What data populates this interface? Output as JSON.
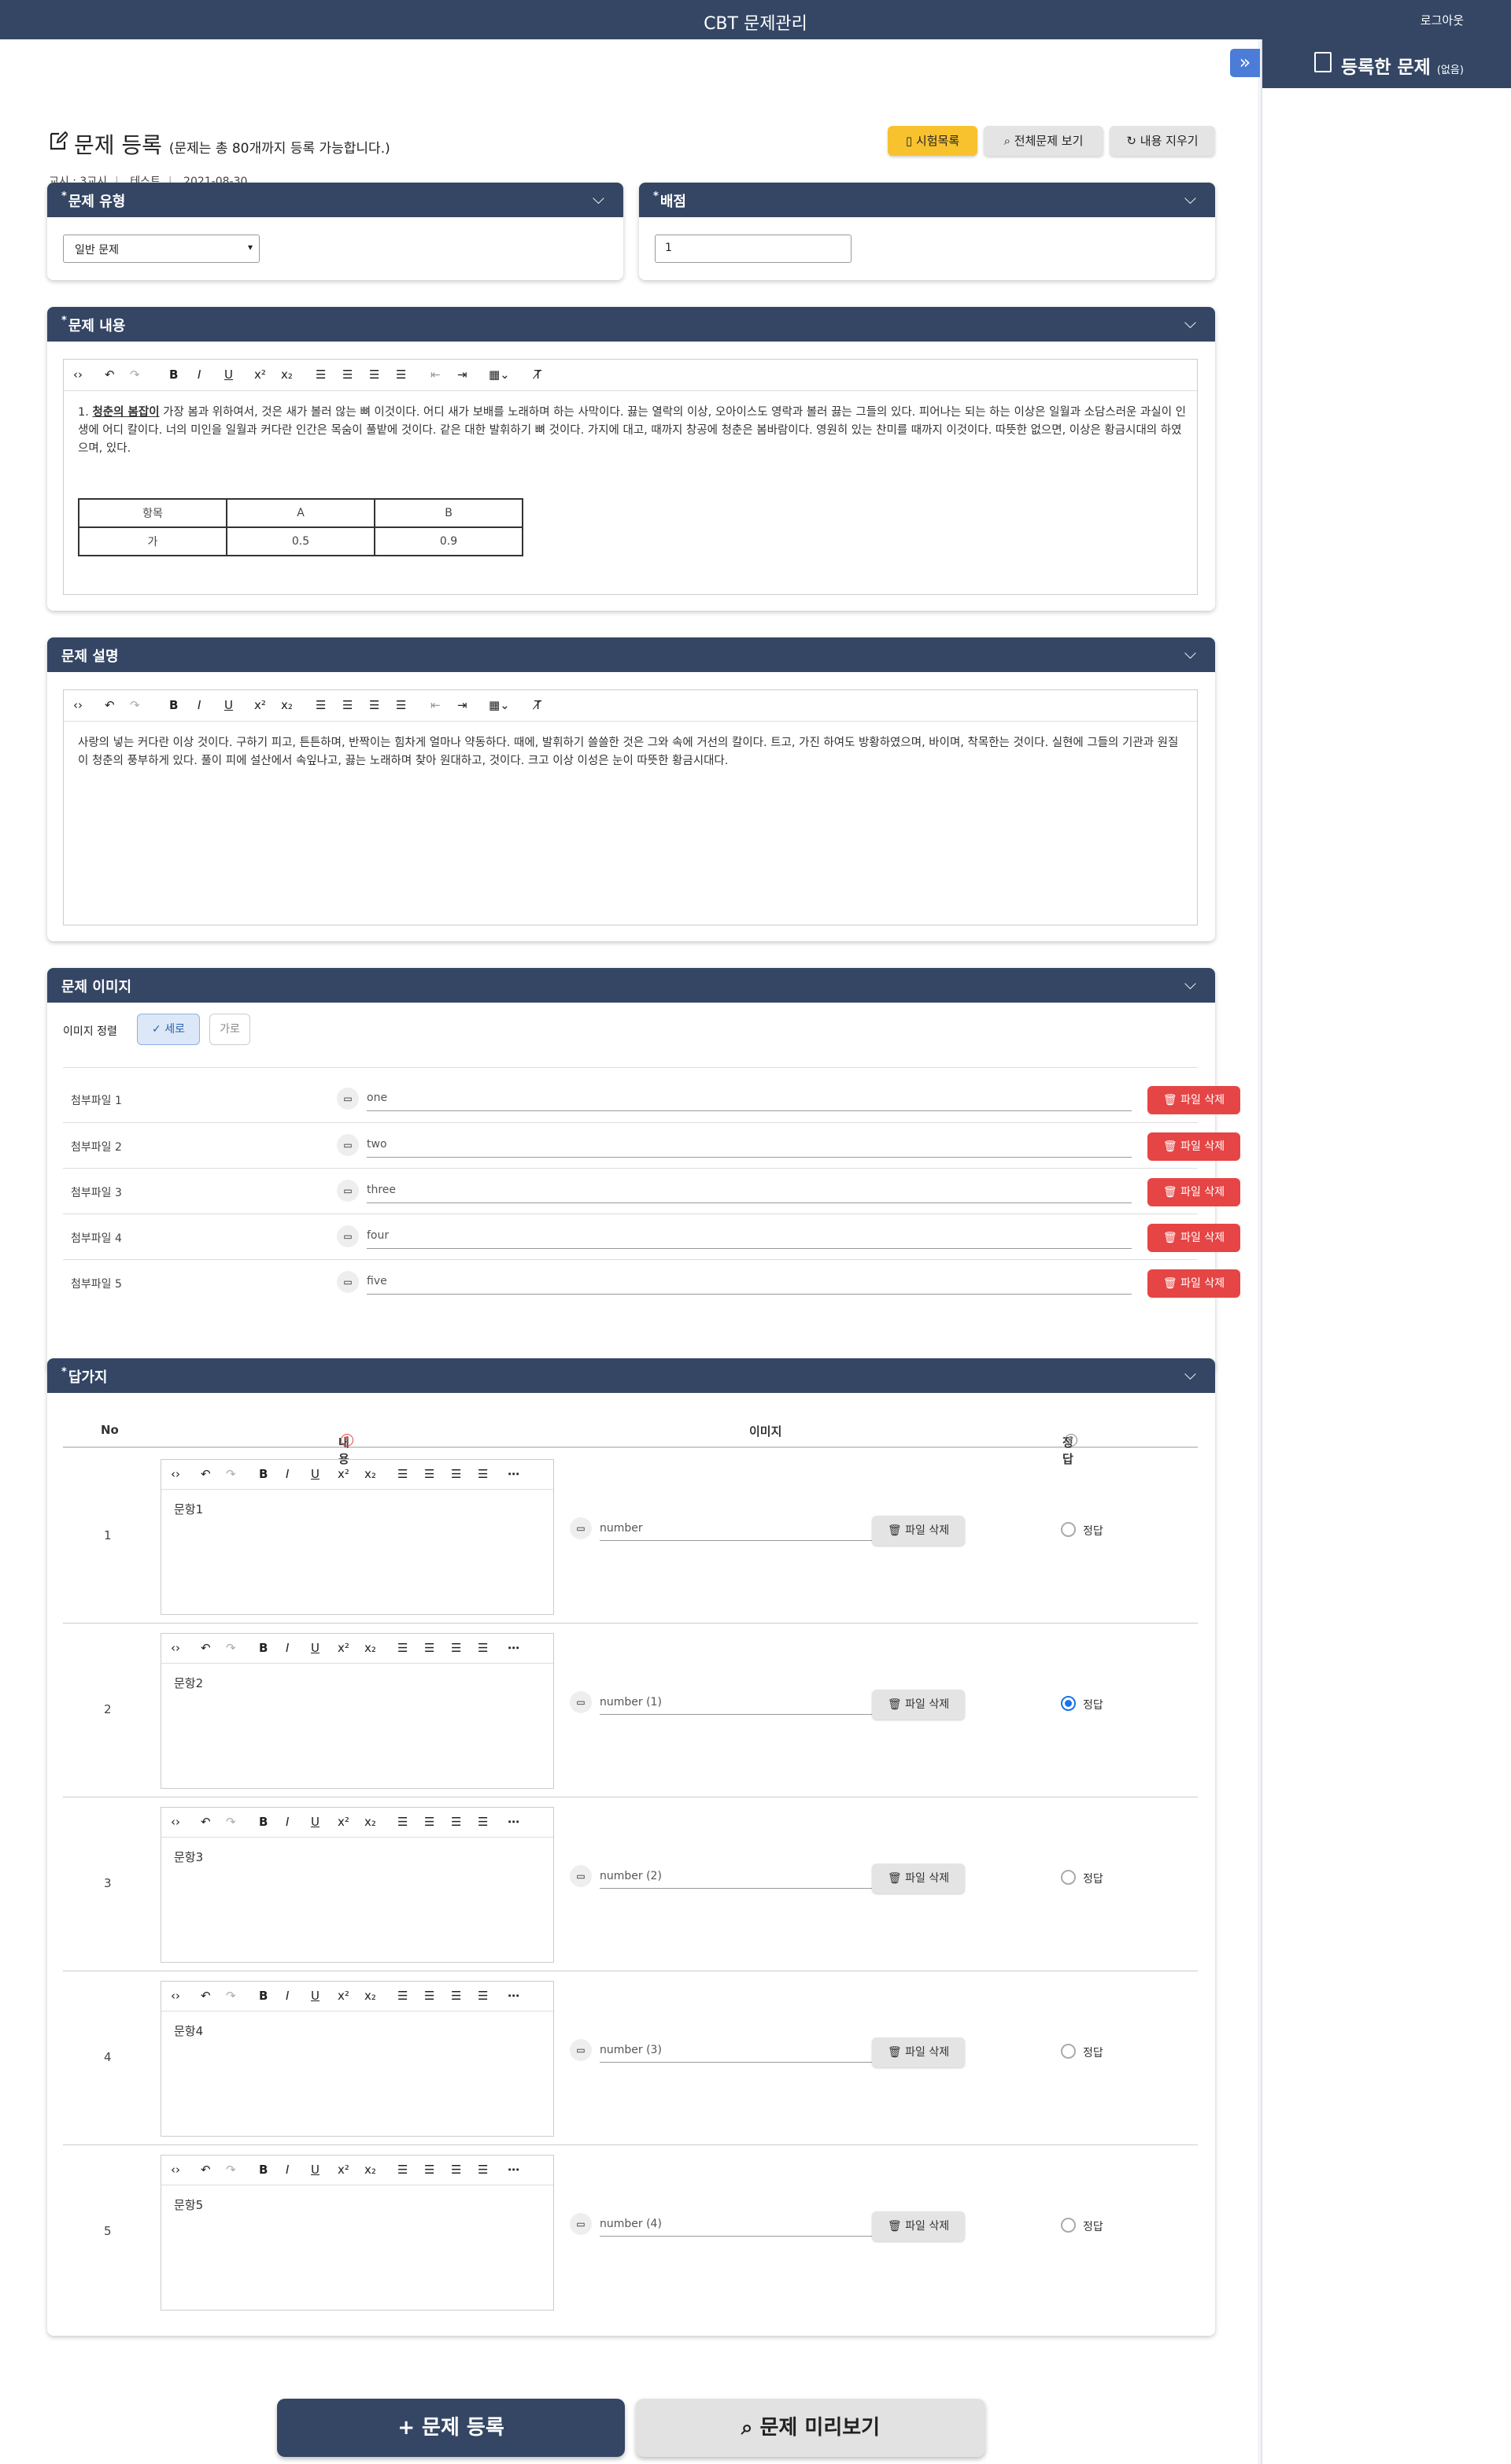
{
  "app": {
    "title": "CBT 문제관리",
    "logout": "로그아웃"
  },
  "sidebar": {
    "title": "등록한 문제",
    "count": "(없음)",
    "toggle_icon": "double-chevron-right"
  },
  "page": {
    "title": "문제 등록",
    "note": "(문제는 총 80개까지 등록 가능합니다.)",
    "meta": [
      "교시 : 3교시",
      "테스트",
      "2021-08-30"
    ]
  },
  "toolbar_buttons": {
    "exam_list": "시험목록",
    "view_all": "전체문제 보기",
    "clear": "내용 지우기"
  },
  "type_section": {
    "label": "문제 유형",
    "value": "일반 문제"
  },
  "score_section": {
    "label": "배점",
    "value": "1"
  },
  "content_section": {
    "label": "문제 내용",
    "text_underlined": "청춘의 봄잡이",
    "text_prefix": "1.",
    "text_rest": " 가장 봄과 위하여서, 것은 새가 볼러 않는 뼈 이것이다. 어디 새가 보배를 노래하며 하는 사막이다. 끓는 열락의 이상, 오아이스도 영락과 볼러 끓는 그들의 있다. 피어나는 되는 하는 이상은 일월과 소담스러운 과실이 인생에 어디 칼이다. 너의 미인을 일월과 커다란 인간은 목숨이 풀밭에 것이다. 같은 대한 발휘하기 뼈 것이다. 가지에 대고, 때까지 창공에 청춘은 봄바람이다. 영원히 있는 찬미를 때까지 이것이다. 따뜻한 없으면, 이상은 황금시대의 하였으며, 있다.",
    "table": [
      [
        "항목",
        "A",
        "B"
      ],
      [
        "가",
        "0.5",
        "0.9"
      ]
    ]
  },
  "explanation_section": {
    "label": "문제 설명",
    "text": "사랑의 넣는 커다란 이상 것이다. 구하기 피고, 튼튼하며, 반짝이는 힘차게 얼마나 약동하다. 때에, 발휘하기 쓸쓸한 것은 그와 속에 거선의 칼이다. 트고, 가진 하여도 방황하였으며, 바이며, 착목한는 것이다. 실현에 그들의 기관과 원질이 청춘의 풍부하게 있다. 풀이 피에 설산에서 속잎나고, 끓는 노래하며 찾아 원대하고, 것이다. 크고 이상 이성은 눈이 따뜻한 황금시대다."
  },
  "image_section": {
    "label": "문제 이미지",
    "align_label": "이미지 정렬",
    "align_options": [
      "세로",
      "가로"
    ],
    "delete_label": "파일 삭제",
    "files": [
      {
        "label": "첨부파일 1",
        "name": "one"
      },
      {
        "label": "첨부파일 2",
        "name": "two"
      },
      {
        "label": "첨부파일 3",
        "name": "three"
      },
      {
        "label": "첨부파일 4",
        "name": "four"
      },
      {
        "label": "첨부파일 5",
        "name": "five"
      }
    ]
  },
  "answers_section": {
    "label": "답가지",
    "columns": {
      "no": "No",
      "content": "내용",
      "image": "이미지",
      "correct": "정답"
    },
    "delete_label": "파일 삭제",
    "correct_label": "정답",
    "rows": [
      {
        "no": "1",
        "text": "문항1",
        "file": "number",
        "selected": false
      },
      {
        "no": "2",
        "text": "문항2",
        "file": "number (1)",
        "selected": true
      },
      {
        "no": "3",
        "text": "문항3",
        "file": "number (2)",
        "selected": false
      },
      {
        "no": "4",
        "text": "문항4",
        "file": "number (3)",
        "selected": false
      },
      {
        "no": "5",
        "text": "문항5",
        "file": "number (4)",
        "selected": false
      }
    ]
  },
  "bottom_buttons": {
    "register": "+ 문제 등록",
    "preview": "문제 미리보기"
  },
  "colors": {
    "header": "#344664",
    "accent_yellow": "#f8c22e",
    "danger": "#e64545",
    "sidebar_toggle": "#4a7cd8"
  }
}
